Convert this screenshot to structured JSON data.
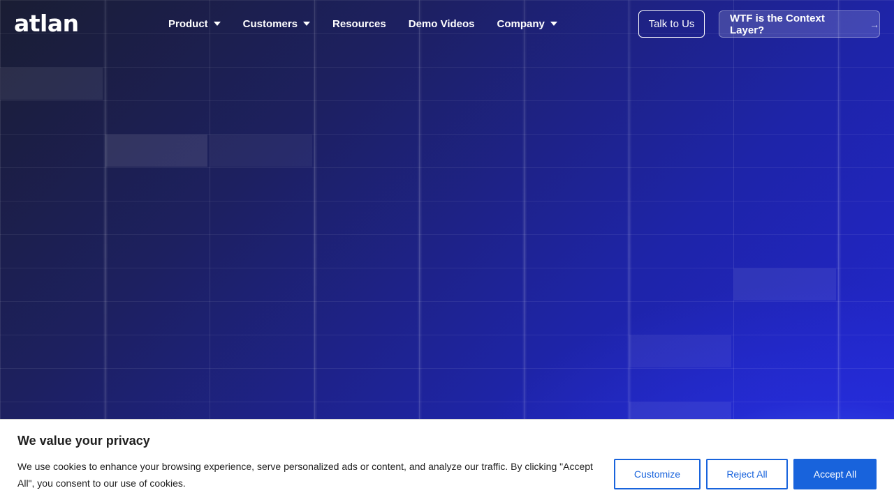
{
  "nav": {
    "logo": "atlan",
    "items": [
      {
        "label": "Product",
        "has_dropdown": true
      },
      {
        "label": "Customers",
        "has_dropdown": true
      },
      {
        "label": "Resources",
        "has_dropdown": false
      },
      {
        "label": "Demo Videos",
        "has_dropdown": false
      },
      {
        "label": "Company",
        "has_dropdown": true
      }
    ],
    "talk_button": "Talk to Us",
    "cta_button": "WTF is the Context Layer?",
    "cta_icon": "arrow-right-icon"
  },
  "cookie_banner": {
    "title": "We value your privacy",
    "text": "We use cookies to enhance your browsing experience, serve personalized ads or content, and analyze our traffic. By clicking \"Accept All\", you consent to our use of cookies.",
    "customize_label": "Customize",
    "reject_label": "Reject All",
    "accept_label": "Accept All"
  },
  "colors": {
    "accent": "#1863dc",
    "hero_dark": "#1a1d33",
    "hero_blue": "#2327d8"
  }
}
